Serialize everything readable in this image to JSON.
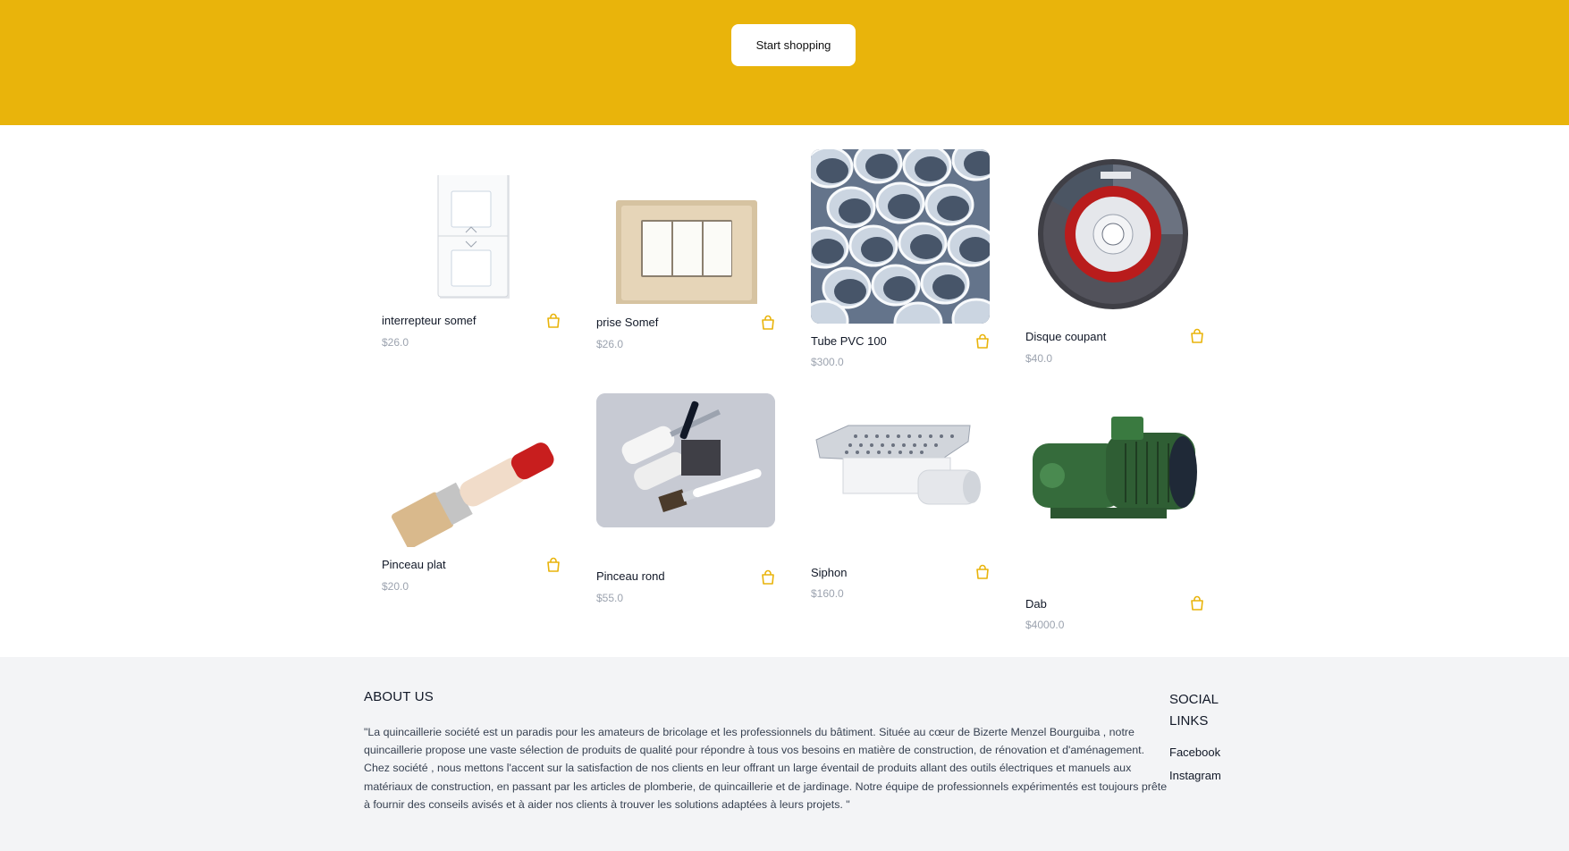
{
  "hero": {
    "cta_label": "Start shopping"
  },
  "products": [
    {
      "name": "interrepteur somef",
      "price": "$26.0",
      "icon": "bag-icon"
    },
    {
      "name": "prise Somef",
      "price": "$26.0",
      "icon": "bag-icon"
    },
    {
      "name": "Tube PVC 100",
      "price": "$300.0",
      "icon": "bag-icon"
    },
    {
      "name": "Disque coupant",
      "price": "$40.0",
      "icon": "bag-icon"
    },
    {
      "name": "Pinceau plat",
      "price": "$20.0",
      "icon": "bag-icon"
    },
    {
      "name": "Pinceau rond",
      "price": "$55.0",
      "icon": "bag-icon"
    },
    {
      "name": "Siphon",
      "price": "$160.0",
      "icon": "bag-icon"
    },
    {
      "name": "Dab",
      "price": "$4000.0",
      "icon": "bag-icon"
    }
  ],
  "footer": {
    "about_title": "ABOUT US",
    "about_paragraph_1": "\"La quincaillerie société est un paradis pour les amateurs de bricolage et les professionnels du bâtiment. Située au cœur de Bizerte Menzel Bourguiba , notre quincaillerie propose une vaste sélection de produits de qualité pour répondre à tous vos besoins en matière de construction, de rénovation et d'aménagement.",
    "about_paragraph_2": "Chez société , nous mettons l'accent sur la satisfaction de nos clients en leur offrant un large éventail de produits allant des outils électriques et manuels aux matériaux de construction, en passant par les articles de plomberie, de quincaillerie et de jardinage. Notre équipe de professionnels expérimentés est toujours prête à fournir des conseils avisés et à aider nos clients à trouver les solutions adaptées à leurs projets. \"",
    "social_title": "SOCIAL LINKS",
    "social_links": [
      "Facebook",
      "Instagram"
    ]
  },
  "colors": {
    "brand_yellow": "#e9b40b",
    "footer_bg": "#f3f4f6",
    "price_gray": "#9ca3af"
  }
}
